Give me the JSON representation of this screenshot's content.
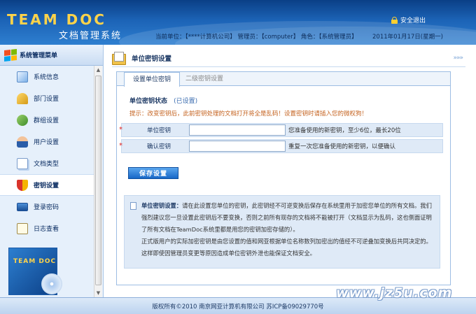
{
  "header": {
    "logo": "TEAM DOC",
    "subtitle": "文档管理系统",
    "logout": "安全退出",
    "unit": "当前单位：【****计算机公司】",
    "admin": "管理员：【computer】",
    "role": "角色：【系统管理员】",
    "date": "2011年01月17日(星期一)"
  },
  "sidebar": {
    "title": "系统管理菜单",
    "items": [
      {
        "label": "系统信息",
        "icon": "system-info-icon"
      },
      {
        "label": "部门设置",
        "icon": "department-icon"
      },
      {
        "label": "群组设置",
        "icon": "group-icon"
      },
      {
        "label": "用户设置",
        "icon": "user-icon"
      },
      {
        "label": "文档类型",
        "icon": "document-type-icon"
      },
      {
        "label": "密钥设置",
        "icon": "shield-icon"
      },
      {
        "label": "登录密码",
        "icon": "monitor-icon"
      },
      {
        "label": "日志查看",
        "icon": "log-icon"
      }
    ],
    "promo": "TEAM DOC"
  },
  "main": {
    "title": "单位密钥设置",
    "chevrons": "»»»",
    "tabs": [
      "设置单位密钥",
      "二级密钥设置"
    ],
    "status_label": "单位密钥状态",
    "status_value": "(已设置)",
    "hint": "提示：改变密钥后，此前密钥处理的文档打开将全是乱码！设置密钥时请插入您的微权狗！",
    "fields": [
      {
        "label": "单位密钥",
        "value": "",
        "desc": "您准备使用的新密钥，至少6位，最长20位"
      },
      {
        "label": "确认密钥",
        "value": "",
        "desc": "重复一次您准备使用的新密钥，以便确认"
      }
    ],
    "save_label": "保存设置",
    "note_title": "单位密钥设置：",
    "note_p1": "请在此设置您单位的密钥，此密钥经不可逆变换后保存在系统里用于加密您单位的所有文档。我们强烈建议您一旦设置此密钥后不要变换，否则之前所有现存的文档将不能被打开（文档显示为乱码，这也侧面证明了所有文档在TeamDoc系统里都是用您的密钥加密存储的）。",
    "note_p2": "正式版用户的实际加密密钥是由您设置的值和网亚根据单位名称数列加密出的值经不可逆叠加变换后共同决定的。这样即使因管理员变更等原因造成单位密钥外泄也能保证文档安全。"
  },
  "footer": {
    "copyright": "版权所有©2010  南京网亚计算机有限公司  苏ICP备09029770号"
  },
  "watermark": "www.jz5u.com"
}
